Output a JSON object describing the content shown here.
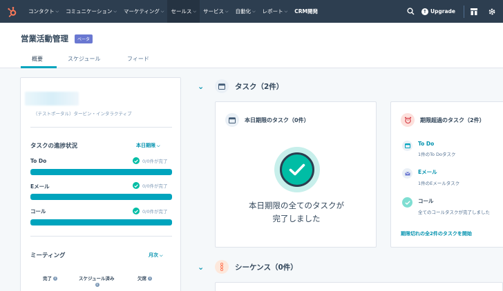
{
  "nav": {
    "items": [
      {
        "label": "コンタクト",
        "active": false
      },
      {
        "label": "コミュニケーション",
        "active": false
      },
      {
        "label": "マーケティング",
        "active": false
      },
      {
        "label": "セールス",
        "active": true
      },
      {
        "label": "サービス",
        "active": false
      },
      {
        "label": "自動化",
        "active": false
      },
      {
        "label": "レポート",
        "active": false
      },
      {
        "label": "CRM開発",
        "active": false
      }
    ],
    "upgrade_label": "Upgrade"
  },
  "header": {
    "title": "営業活動管理",
    "badge": "ベータ",
    "tabs": [
      "概要",
      "スケジュール",
      "フィード"
    ]
  },
  "left_panel": {
    "subtitle": "（テストポータル）タービン・インタラクティブ",
    "progress": {
      "title": "タスクの進捗状況",
      "filter": "本日期限",
      "rows": [
        {
          "label": "To Do",
          "status": "0/0件が完了"
        },
        {
          "label": "Eメール",
          "status": "0/0件が完了"
        },
        {
          "label": "コール",
          "status": "0/0件が完了"
        }
      ]
    },
    "meetings": {
      "title": "ミーティング",
      "filter": "月次",
      "columns": [
        "完了",
        "スケジュール済み",
        "欠席"
      ]
    }
  },
  "tasks_section": {
    "title": "タスク（2件）",
    "today_card": {
      "title": "本日期限のタスク（0件）",
      "message_line1": "本日期限の全てのタスクが",
      "message_line2": "完了しました"
    },
    "overdue_card": {
      "title": "期限超過のタスク（2件）",
      "items": [
        {
          "name": "To Do",
          "sub": "1件のTo Doタスク"
        },
        {
          "name": "Eメール",
          "sub": "1件のEメールタスク"
        },
        {
          "name": "コール",
          "sub": "全てのコールタスクが完了しました"
        }
      ],
      "link": "期限切れの全2件のタスクを開始"
    }
  },
  "sequences_section": {
    "title": "シーケンス（0件）"
  },
  "colors": {
    "nav_bg": "#2d3e50",
    "accent": "#00a4bd",
    "link": "#0091ae",
    "success": "#00bda5",
    "beta": "#6a78d1"
  },
  "icons": [
    "hubspot-logo",
    "search-icon",
    "upgrade-arrow-icon",
    "marketplace-icon",
    "settings-gear-icon",
    "calendar-icon",
    "alarm-clock-icon",
    "email-icon",
    "check-icon",
    "sequence-icon",
    "info-icon"
  ]
}
